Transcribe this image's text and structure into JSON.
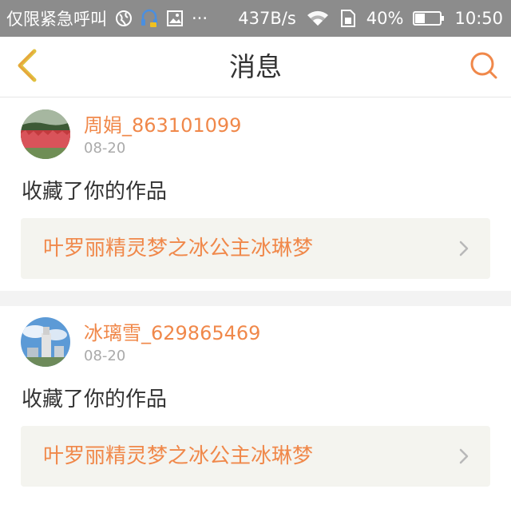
{
  "status_bar": {
    "carrier": "仅限紧急呼叫",
    "more": "···",
    "speed": "437B/s",
    "battery_percent": "40%",
    "battery_level": 0.4,
    "time": "10:50",
    "icons": [
      "globe-icon",
      "headset-icon",
      "image-icon",
      "wifi-icon",
      "sim-icon",
      "battery-icon"
    ]
  },
  "nav": {
    "title": "消息",
    "back_icon": "chevron-left-icon",
    "search_icon": "search-icon",
    "accent": "#f0884a"
  },
  "messages": [
    {
      "username": "周娟_863101099",
      "date": "08-20",
      "action": "收藏了你的作品",
      "work_title": "叶罗丽精灵梦之冰公主冰琳梦"
    },
    {
      "username": "冰璃雪_629865469",
      "date": "08-20",
      "action": "收藏了你的作品",
      "work_title": "叶罗丽精灵梦之冰公主冰琳梦"
    }
  ],
  "colors": {
    "status_bg": "#8c8c8c",
    "accent": "#f0884a",
    "work_box_bg": "#f4f4ef",
    "separator": "#f3f3f3"
  }
}
